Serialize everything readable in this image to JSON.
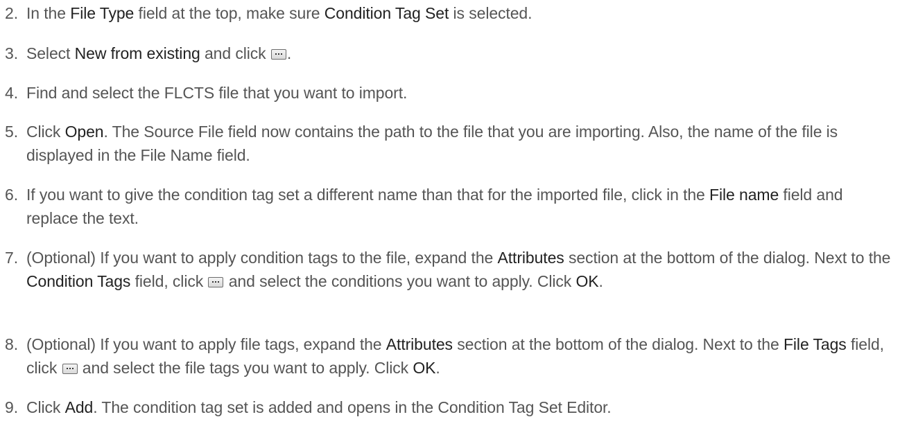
{
  "steps": [
    {
      "num": "2.",
      "t1": "In the ",
      "b1": "File Type",
      "t2": " field at the top, make sure ",
      "b2": "Condition Tag Set",
      "t3": " is selected."
    },
    {
      "num": "3.",
      "t1": "Select ",
      "b1": "New from existing",
      "t2": " and click ",
      "icon": "browse-ellipsis-button-icon",
      "t3": "."
    },
    {
      "num": "4.",
      "t1": "Find and select the FLCTS file that you want to import."
    },
    {
      "num": "5.",
      "t1": "Click ",
      "b1": "Open",
      "t2": ". The Source File field now contains the path to the file that you are importing. Also, the name of the file is displayed in the File Name field."
    },
    {
      "num": "6.",
      "t1": "If you want to give the condition tag set a different name than that for the imported file, click in the ",
      "b1": "File name",
      "t2": " field and replace the text."
    },
    {
      "num": "7.",
      "t1": "(Optional) If you want to apply condition tags to the file, expand the ",
      "b1": "Attributes",
      "t2": " section at the bottom of the dialog. Next to the ",
      "b2": "Condition Tags",
      "t3": " field, click ",
      "icon": "browse-ellipsis-button-icon",
      "t4": " and select the conditions you want to apply. Click ",
      "b3": "OK",
      "t5": "."
    },
    {
      "num": "8.",
      "t1": "(Optional) If you want to apply file tags, expand the ",
      "b1": "Attributes",
      "t2": " section at the bottom of the dialog. Next to the ",
      "b2": "File Tags",
      "t3": " field, click ",
      "icon": "browse-ellipsis-button-icon",
      "t4": " and select the file tags you want to apply. Click ",
      "b3": "OK",
      "t5": "."
    },
    {
      "num": "9.",
      "t1": "Click ",
      "b1": "Add",
      "t2": ". The condition tag set is added and opens in the Condition Tag Set Editor."
    }
  ]
}
